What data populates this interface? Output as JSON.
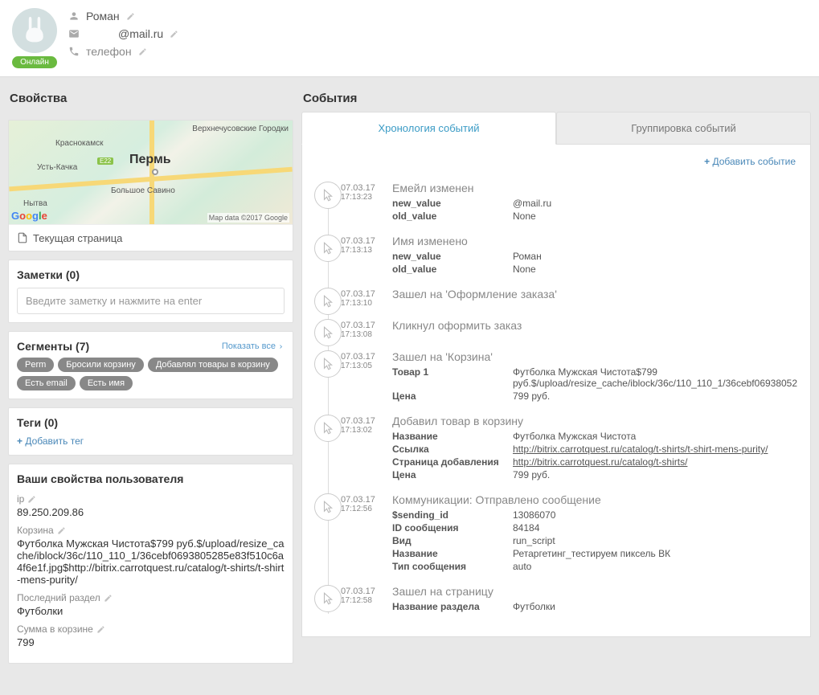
{
  "header": {
    "name": "Роман",
    "email_display": "@mail.ru",
    "phone_label": "телефон",
    "status": "Онлайн"
  },
  "left": {
    "section_title": "Свойства",
    "map": {
      "city": "Пермь",
      "labels": [
        "Краснокамск",
        "Усть-Качка",
        "Большое Савино",
        "Нытва",
        "Верхнечусовские Городки"
      ],
      "route_badge": "E22",
      "attribution": "Map data ©2017 Google"
    },
    "current_page": "Текущая страница",
    "notes": {
      "title": "Заметки (0)",
      "placeholder": "Введите заметку и нажмите на enter"
    },
    "segments": {
      "title": "Сегменты (7)",
      "show_all": "Показать все",
      "chips": [
        "Perm",
        "Бросили корзину",
        "Добавлял товары в корзину",
        "Есть email",
        "Есть имя"
      ]
    },
    "tags": {
      "title": "Теги (0)",
      "add": "Добавить тег"
    },
    "user_props": {
      "title": "Ваши свойства пользователя",
      "rows": [
        {
          "label": "ip",
          "value": "89.250.209.86"
        },
        {
          "label": "Корзина",
          "value": "Футболка Мужская Чистота$799 руб.$/upload/resize_cache/iblock/36c/110_110_1/36cebf0693805285e83f510c6a4f6e1f.jpg$http://bitrix.carrotquest.ru/catalog/t-shirts/t-shirt-mens-purity/"
        },
        {
          "label": "Последний раздел",
          "value": "Футболки"
        },
        {
          "label": "Сумма в корзине",
          "value": "799"
        }
      ]
    }
  },
  "right": {
    "section_title": "События",
    "tabs": {
      "chronology": "Хронология событий",
      "grouping": "Группировка событий"
    },
    "add_event": "Добавить событие",
    "events": [
      {
        "date": "07.03.17",
        "time": "17:13:23",
        "title": "Емейл изменен",
        "fields": [
          {
            "k": "new_value",
            "v": "@mail.ru"
          },
          {
            "k": "old_value",
            "v": "None"
          }
        ]
      },
      {
        "date": "07.03.17",
        "time": "17:13:13",
        "title": "Имя изменено",
        "fields": [
          {
            "k": "new_value",
            "v": "Роман"
          },
          {
            "k": "old_value",
            "v": "None"
          }
        ]
      },
      {
        "date": "07.03.17",
        "time": "17:13:10",
        "title": "Зашел на 'Оформление заказа'",
        "fields": []
      },
      {
        "date": "07.03.17",
        "time": "17:13:08",
        "title": "Кликнул оформить заказ",
        "fields": []
      },
      {
        "date": "07.03.17",
        "time": "17:13:05",
        "title": "Зашел на 'Корзина'",
        "fields": [
          {
            "k": "Товар 1",
            "v": "Футболка Мужская Чистота$799 руб.$/upload/resize_cache/iblock/36c/110_110_1/36cebf06938052"
          },
          {
            "k": "Цена",
            "v": "799 руб."
          }
        ]
      },
      {
        "date": "07.03.17",
        "time": "17:13:02",
        "title": "Добавил товар в корзину",
        "fields": [
          {
            "k": "Название",
            "v": "Футболка Мужская Чистота"
          },
          {
            "k": "Ссылка",
            "v": "http://bitrix.carrotquest.ru/catalog/t-shirts/t-shirt-mens-purity/",
            "link": true
          },
          {
            "k": "Страница добавления",
            "v": "http://bitrix.carrotquest.ru/catalog/t-shirts/",
            "link": true
          },
          {
            "k": "Цена",
            "v": "799 руб."
          }
        ]
      },
      {
        "date": "07.03.17",
        "time": "17:12:56",
        "title": "Коммуникации: Отправлено сообщение",
        "fields": [
          {
            "k": "$sending_id",
            "v": "13086070"
          },
          {
            "k": "ID сообщения",
            "v": "84184"
          },
          {
            "k": "Вид",
            "v": "run_script"
          },
          {
            "k": "Название",
            "v": "Ретаргетинг_тестируем пиксель ВК"
          },
          {
            "k": "Тип сообщения",
            "v": "auto"
          }
        ]
      },
      {
        "date": "07.03.17",
        "time": "17:12:58",
        "title": "Зашел на страницу",
        "fields": [
          {
            "k": "Название раздела",
            "v": "Футболки"
          }
        ]
      }
    ]
  }
}
